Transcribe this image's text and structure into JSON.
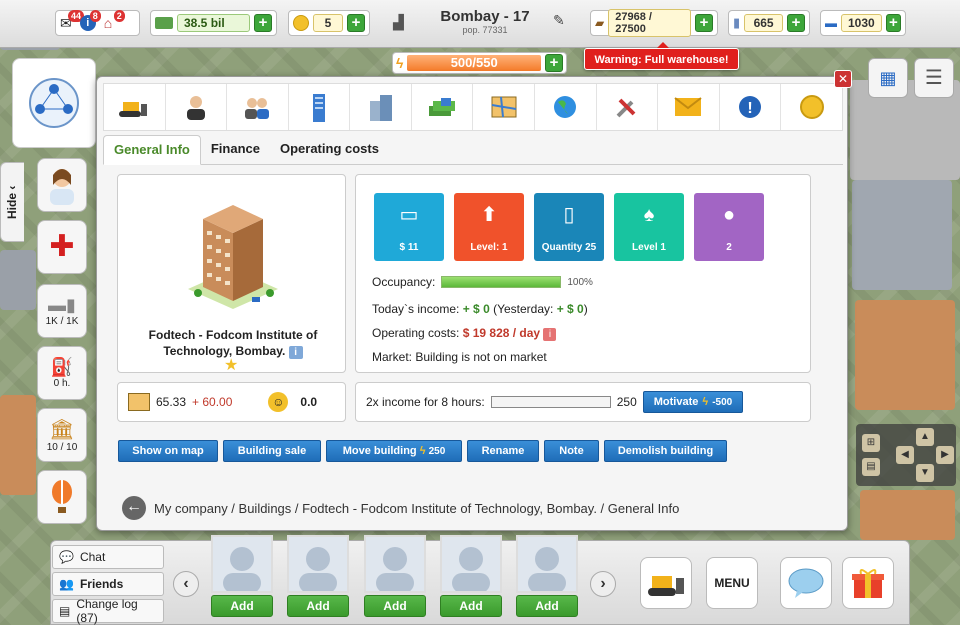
{
  "topbar": {
    "mail_badge": "44",
    "info_badge": "8",
    "home_badge": "2",
    "money": "38.5 bil",
    "coins": "5",
    "city_name": "Bombay - 17",
    "population": "pop. 77331",
    "warehouse": "27968 / 27500",
    "res2": "665",
    "res3": "1030",
    "energy": "500/550",
    "warning": "Warning: Full warehouse!"
  },
  "sidebar": {
    "hide_label": "Hide",
    "truck_label": "1K / 1K",
    "fuel_label": "0 h.",
    "bank_label": "10 / 10"
  },
  "tabs": [
    "General Info",
    "Finance",
    "Operating costs"
  ],
  "building": {
    "name": "Fodtech - Fodcom Institute of Technology, Bombay.",
    "stat_a": "65.33",
    "stat_a_plus": "+ 60.00",
    "happiness": "0.0"
  },
  "tiles": [
    {
      "label": "$ 11",
      "color": "#1fa9d8"
    },
    {
      "label": "Level: 1",
      "color": "#f0522b"
    },
    {
      "label": "Quantity 25",
      "color": "#1a86b8"
    },
    {
      "label": "Level 1",
      "color": "#18c4a0"
    },
    {
      "label": "2",
      "color": "#a265c4"
    }
  ],
  "info": {
    "occupancy_label": "Occupancy:",
    "occupancy_value": "100%",
    "occupancy_fraction": 1.0,
    "income_label": "Today`s income:",
    "income_value": "+ $ 0",
    "yesterday_label": "(Yesterday:",
    "yesterday_value": "+ $ 0",
    "yesterday_close": ")",
    "opcost_label": "Operating costs:",
    "opcost_value": "$ 19 828 / day",
    "market": "Market: Building is not on market"
  },
  "motivate": {
    "label": "2x income for 8 hours:",
    "value": "250",
    "button": "Motivate",
    "cost": "-500"
  },
  "actions": {
    "show_on_map": "Show on map",
    "building_sale": "Building sale",
    "move_building": "Move building",
    "move_cost": "250",
    "rename": "Rename",
    "note": "Note",
    "demolish": "Demolish building"
  },
  "breadcrumb": "My company / Buildings / Fodtech - Fodcom Institute of Technology, Bombay. / General Info",
  "bottom": {
    "chat": "Chat",
    "friends": "Friends",
    "changelog": "Change log (87)",
    "add_label": "Add",
    "menu": "MENU"
  }
}
